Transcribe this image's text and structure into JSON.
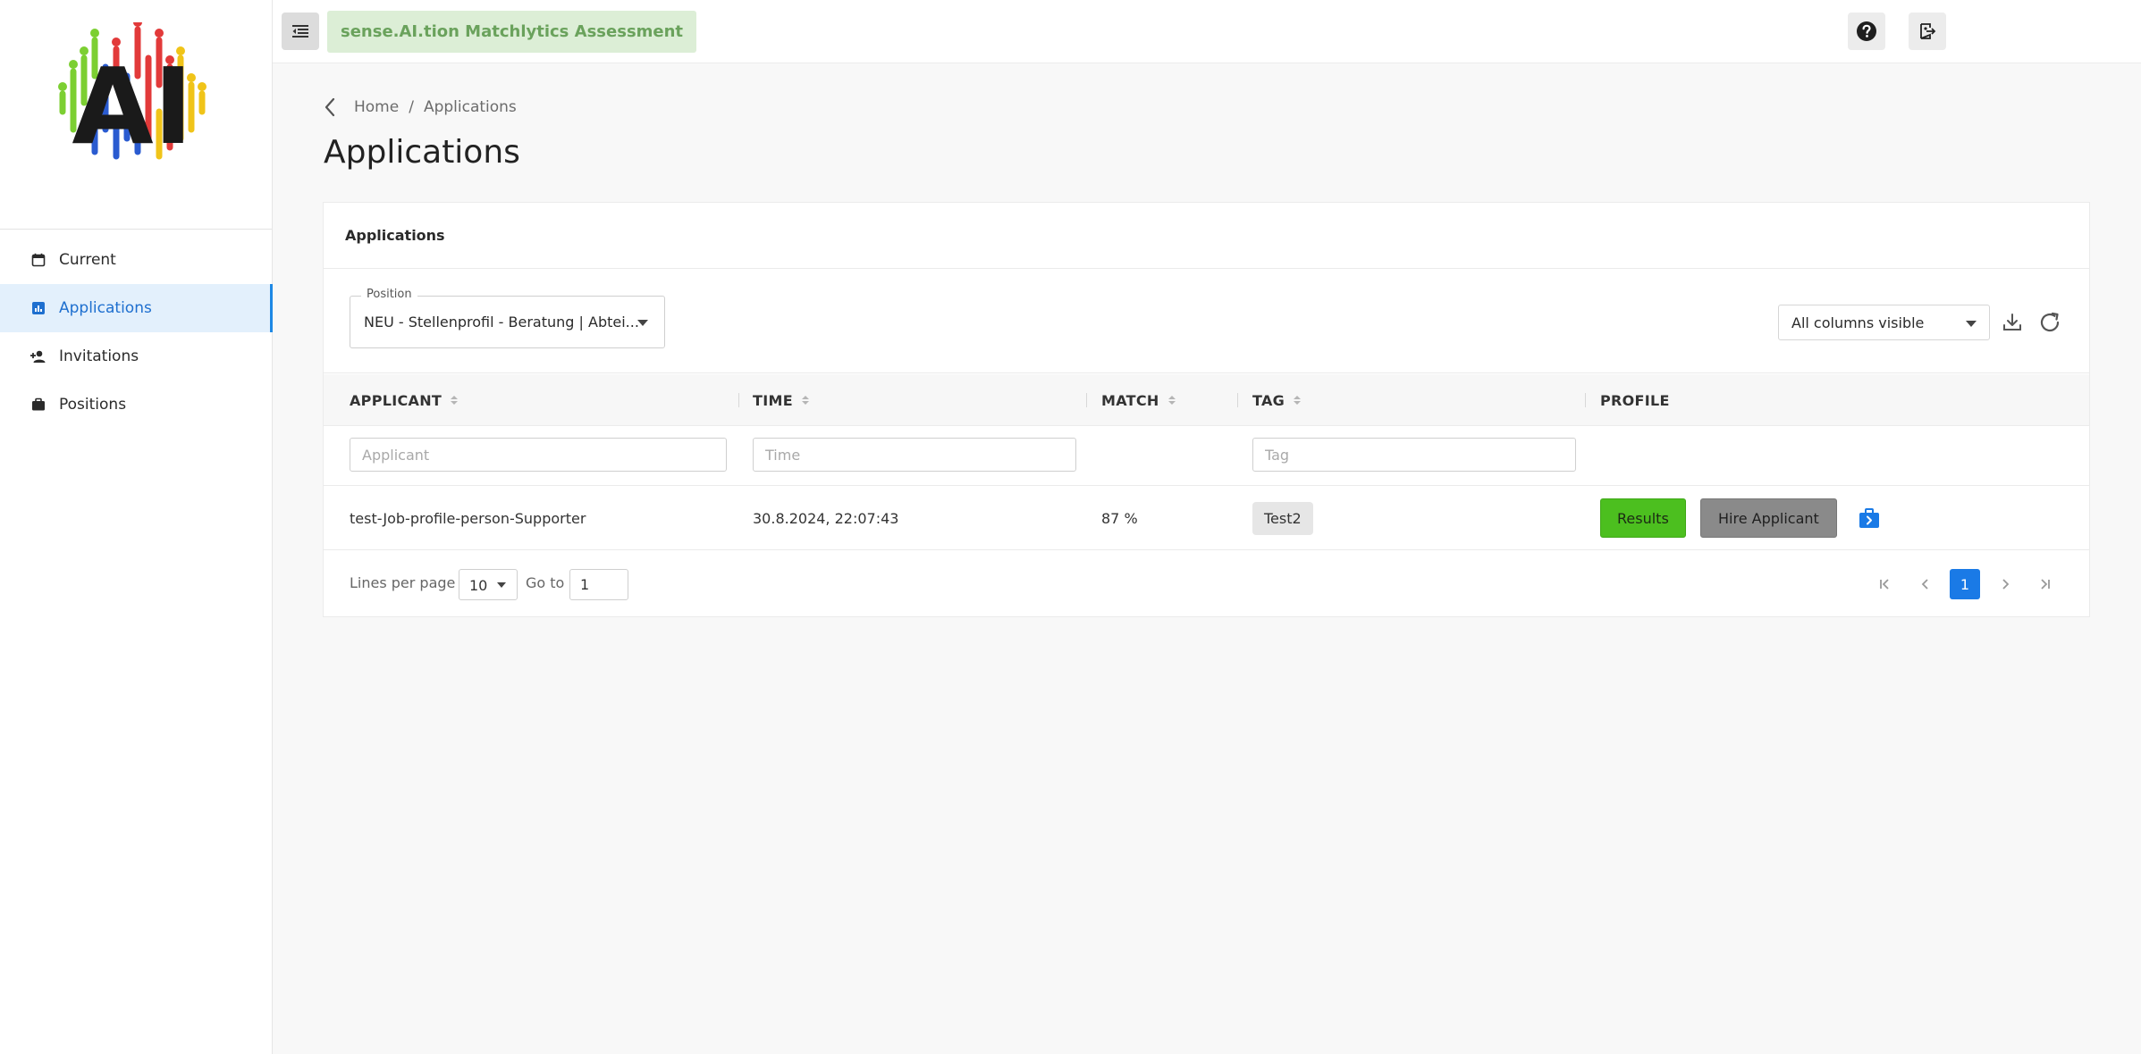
{
  "sidebar": {
    "logo_text": "AI",
    "items": [
      {
        "label": "Current",
        "icon": "calendar-icon",
        "active": false
      },
      {
        "label": "Applications",
        "icon": "chart-icon",
        "active": true
      },
      {
        "label": "Invitations",
        "icon": "person-add-icon",
        "active": false
      },
      {
        "label": "Positions",
        "icon": "briefcase-icon",
        "active": false
      }
    ]
  },
  "topbar": {
    "title": "sense.AI.tion Matchlytics Assessment",
    "help_icon": "help-icon",
    "logout_icon": "logout-icon"
  },
  "breadcrumb": {
    "home": "Home",
    "separator": "/",
    "current": "Applications"
  },
  "page": {
    "title": "Applications"
  },
  "card": {
    "header": "Applications",
    "position_label": "Position",
    "position_value": "NEU - Stellenprofil - Beratung | Abtei...",
    "columns_value": "All columns visible"
  },
  "table": {
    "headers": {
      "applicant": "APPLICANT",
      "time": "TIME",
      "match": "MATCH",
      "tag": "TAG",
      "profile": "PROFILE"
    },
    "filters": {
      "applicant_placeholder": "Applicant",
      "time_placeholder": "Time",
      "tag_placeholder": "Tag"
    },
    "rows": [
      {
        "applicant": "test-Job-profile-person-Supporter",
        "time": "30.8.2024, 22:07:43",
        "match": "87 %",
        "tag": "Test2",
        "results_label": "Results",
        "hire_label": "Hire Applicant"
      }
    ]
  },
  "pager": {
    "lines_per_page_label": "Lines per page",
    "lines_per_page_value": "10",
    "goto_label": "Go to",
    "goto_value": "1",
    "current_page": "1"
  },
  "colors": {
    "accent": "#1a7ae6",
    "results_green": "#4cbf1f",
    "hire_gray": "#8a8a8a",
    "title_badge_bg": "#dceed6",
    "title_badge_text": "#6aa25c"
  }
}
